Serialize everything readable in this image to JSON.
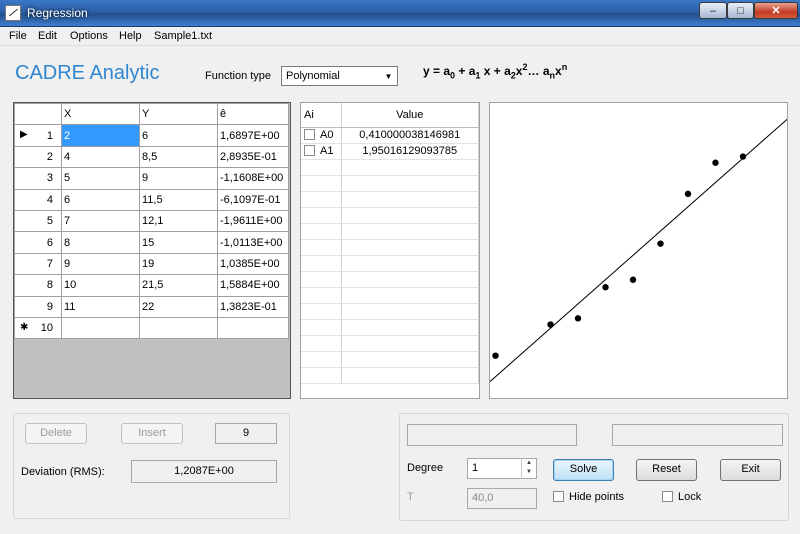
{
  "window": {
    "title": "Regression",
    "minimize": "–",
    "maximize": "□",
    "close": "✕"
  },
  "menu": [
    "File",
    "Edit",
    "Options",
    "Help",
    "Sample1.txt"
  ],
  "brand": "CADRE Analytic",
  "function_type": {
    "label": "Function type",
    "value": "Polynomial"
  },
  "formula": "y = a0 + a1 x + a2x2… anxn",
  "data_grid": {
    "headers": [
      "X",
      "Y",
      "ê"
    ],
    "rows": [
      {
        "n": "1",
        "x": "2",
        "y": "6",
        "e": "1,6897E+00"
      },
      {
        "n": "2",
        "x": "4",
        "y": "8,5",
        "e": "2,8935E-01"
      },
      {
        "n": "3",
        "x": "5",
        "y": "9",
        "e": "-1,1608E+00"
      },
      {
        "n": "4",
        "x": "6",
        "y": "11,5",
        "e": "-6,1097E-01"
      },
      {
        "n": "5",
        "x": "7",
        "y": "12,1",
        "e": "-1,9611E+00"
      },
      {
        "n": "6",
        "x": "8",
        "y": "15",
        "e": "-1,0113E+00"
      },
      {
        "n": "7",
        "x": "9",
        "y": "19",
        "e": "1,0385E+00"
      },
      {
        "n": "8",
        "x": "10",
        "y": "21,5",
        "e": "1,5884E+00"
      },
      {
        "n": "9",
        "x": "11",
        "y": "22",
        "e": "1,3823E-01"
      }
    ],
    "new_row": {
      "marker": "✱",
      "n": "10"
    },
    "current_row_marker": "▶"
  },
  "coefficients": {
    "headers": [
      "Ai",
      "Value"
    ],
    "rows": [
      {
        "name": "A0",
        "value": "0,410000038146981"
      },
      {
        "name": "A1",
        "value": "1,95016129093785"
      }
    ]
  },
  "plot": {
    "points": [
      [
        2,
        6
      ],
      [
        4,
        8.5
      ],
      [
        5,
        9
      ],
      [
        6,
        11.5
      ],
      [
        7,
        12.1
      ],
      [
        8,
        15
      ],
      [
        9,
        19
      ],
      [
        10,
        21.5
      ],
      [
        11,
        22
      ]
    ],
    "fit": {
      "a0": 0.410000038146981,
      "a1": 1.95016129093785
    },
    "xlim": [
      1.8,
      12.6
    ],
    "ylim": [
      2.6,
      26.3
    ]
  },
  "edit_panel": {
    "delete_label": "Delete",
    "insert_label": "Insert",
    "count": "9",
    "deviation_label": "Deviation (RMS):",
    "deviation_value": "1,2087E+00"
  },
  "solve_panel": {
    "status1": "",
    "status2": "",
    "degree_label": "Degree",
    "degree_value": "1",
    "t_label": "T",
    "t_value": "40,0",
    "solve_label": "Solve",
    "reset_label": "Reset",
    "exit_label": "Exit",
    "hide_points_label": "Hide points",
    "lock_label": "Lock"
  }
}
